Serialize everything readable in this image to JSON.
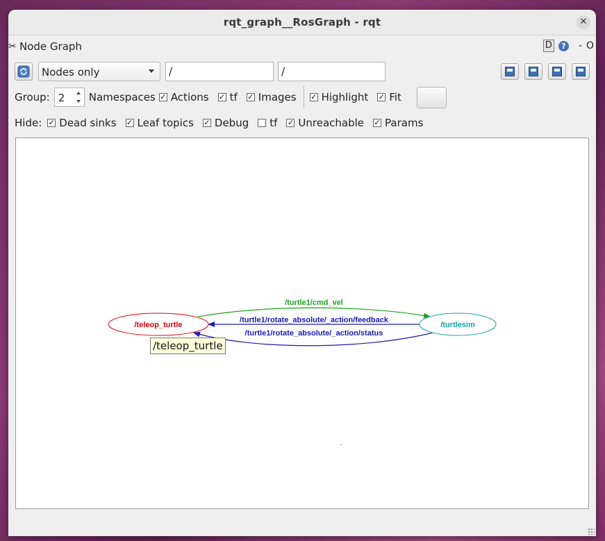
{
  "window": {
    "title": "rqt_graph__RosGraph - rqt",
    "close_icon": "✕"
  },
  "plugin": {
    "icon": "✂",
    "title": "Node Graph",
    "controls": {
      "d_label": "D",
      "help_label": "?",
      "minus_label": "-",
      "o_label": "O"
    }
  },
  "toolbar": {
    "view_mode": "Nodes only",
    "filter_nodes": "/",
    "filter_topics": "/"
  },
  "options": {
    "group_label": "Group:",
    "group_value": "2",
    "namespaces_label": "Namespaces",
    "check_mark": "✓",
    "actions": {
      "label": "Actions",
      "checked": true
    },
    "tf": {
      "label": "tf",
      "checked": true
    },
    "images": {
      "label": "Images",
      "checked": true
    },
    "highlight": {
      "label": "Highlight",
      "checked": true
    },
    "fit": {
      "label": "Fit",
      "checked": true
    }
  },
  "hide": {
    "label": "Hide:",
    "dead_sinks": {
      "label": "Dead sinks",
      "checked": true
    },
    "leaf_topics": {
      "label": "Leaf topics",
      "checked": true
    },
    "debug": {
      "label": "Debug",
      "checked": true
    },
    "tf": {
      "label": "tf",
      "checked": false
    },
    "unreachable": {
      "label": "Unreachable",
      "checked": true
    },
    "params": {
      "label": "Params",
      "checked": true
    }
  },
  "graph": {
    "nodes": {
      "teleop": {
        "label": "/teleop_turtle",
        "color": "#e0000b"
      },
      "turtlesim": {
        "label": "/turtlesim",
        "color": "#14a0a8"
      }
    },
    "edges": {
      "cmd_vel": {
        "label": "/turtle1/cmd_vel",
        "color": "#19a51b"
      },
      "feedback": {
        "label": "/turtle1/rotate_absolute/_action/feedback",
        "color": "#1a1ab0"
      },
      "status": {
        "label": "/turtle1/rotate_absolute/_action/status",
        "color": "#1a1ab0"
      }
    }
  },
  "tooltip": {
    "text": "/teleop_turtle"
  }
}
